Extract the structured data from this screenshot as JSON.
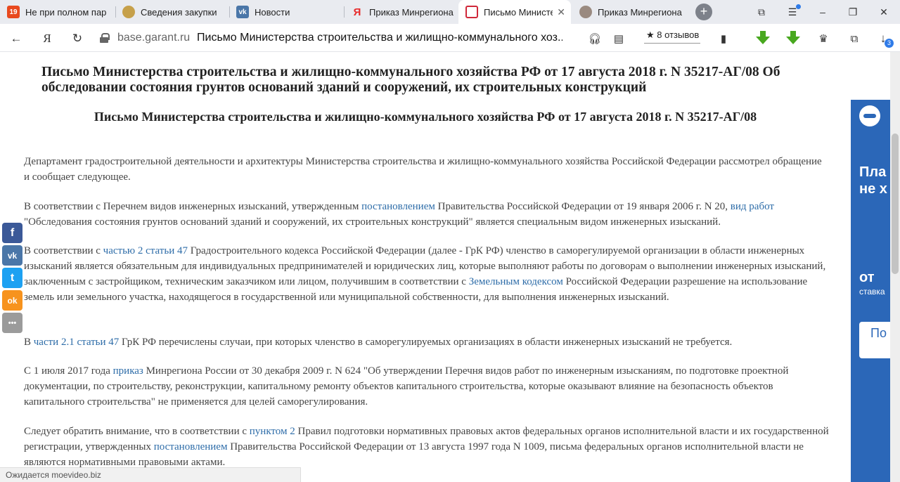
{
  "tabs": [
    {
      "label": "Не при полном пар",
      "favicon_text": "19",
      "favicon_color": "#e8491e"
    },
    {
      "label": "Сведения закупки",
      "favicon_text": "",
      "favicon_color": "#c6a04a"
    },
    {
      "label": "Новости",
      "favicon_text": "vk",
      "favicon_color": "#4a76a8"
    },
    {
      "label": "Приказ Минрегиона",
      "favicon_text": "Я",
      "favicon_color": "#e82a2a"
    },
    {
      "label": "Письмо Министе",
      "favicon_text": "",
      "favicon_color": "#d0283a",
      "active": true
    },
    {
      "label": "Приказ Минрегиона",
      "favicon_text": "",
      "favicon_color": "#9a8a80"
    }
  ],
  "addressbar": {
    "domain": "base.garant.ru",
    "title": "Письмо Министерства строительства и жилищно-коммунального хоз...",
    "reviews_label": "8 отзывов",
    "downloads_count": "3"
  },
  "article": {
    "heading": "Письмо Министерства строительства и жилищно-коммунального хозяйства РФ от 17 августа 2018 г. N 35217-АГ/08 Об обследовании состояния грунтов оснований зданий и сооружений, их строительных конструкций",
    "subheading": "Письмо Министерства строительства и жилищно-коммунального хозяйства РФ от 17 августа 2018 г. N 35217-АГ/08",
    "p1": "Департамент градостроительной деятельности и архитектуры Министерства строительства и жилищно-коммунального хозяйства Российской Федерации рассмотрел обращение и сообщает следующее.",
    "p2": {
      "t1": "В соответствии с Перечнем видов инженерных изысканий, утвержденным ",
      "l1": "постановлением",
      "t2": " Правительства Российской Федерации от 19 января 2006 г. N 20, ",
      "l2": "вид работ",
      "t3": " \"Обследования состояния грунтов оснований зданий и сооружений, их строительных конструкций\" является специальным видом инженерных изысканий."
    },
    "p3": {
      "t1": "В соответствии с ",
      "l1": "частью 2 статьи 47",
      "t2": " Градостроительного кодекса Российской Федерации (далее - ГрК РФ) членство в саморегулируемой организации в области инженерных изысканий является обязательным для индивидуальных предпринимателей и юридических лиц, которые выполняют работы по договорам о выполнении инженерных изысканий, заключенным с застройщиком, техническим заказчиком или лицом, получившим в соответствии с ",
      "l2": "Земельным кодексом",
      "t3": " Российской Федерации разрешение на использование земель или земельного участка, находящегося в государственной или муниципальной собственности, для выполнения инженерных изысканий."
    },
    "p4": {
      "t1": "В ",
      "l1": "части 2.1 статьи 47",
      "t2": " ГрК РФ перечислены случаи, при которых членство в саморегулируемых организациях в области инженерных изысканий не требуется."
    },
    "p5": {
      "t1": "С 1 июля 2017 года ",
      "l1": "приказ",
      "t2": " Минрегиона России от 30 декабря 2009 г. N 624 \"Об утверждении Перечня видов работ по инженерным изысканиям, по подготовке проектной документации, по строительству, реконструкции, капитальному ремонту объектов капитального строительства, которые оказывают влияние на безопасность объектов капитального строительства\" не применяется для целей саморегулирования."
    },
    "p6": {
      "t1": "Следует обратить внимание, что в соответствии с ",
      "l1": "пунктом 2",
      "t2": " Правил подготовки нормативных правовых актов федеральных органов исполнительной власти и их государственной регистрации, утвержденных ",
      "l2": "постановлением",
      "t3": " Правительства Российской Федерации от 13 августа 1997 года N 1009, письма федеральных органов исполнительной власти не являются нормативными правовыми актами."
    }
  },
  "share_buttons": [
    {
      "name": "facebook-share-button",
      "icon": "facebook-icon",
      "glyph": "f",
      "color": "#3b5998"
    },
    {
      "name": "vk-share-button",
      "icon": "vk-icon",
      "glyph": "vk",
      "color": "#4a76a8"
    },
    {
      "name": "twitter-share-button",
      "icon": "twitter-icon",
      "glyph": "t",
      "color": "#1da1f2"
    },
    {
      "name": "odnoklassniki-share-button",
      "icon": "odnoklassniki-icon",
      "glyph": "ok",
      "color": "#f7931e"
    },
    {
      "name": "more-share-button",
      "icon": "more-icon",
      "glyph": "•••",
      "color": "#9b9b9b"
    }
  ],
  "status_text": "Ожидается moevideo.biz",
  "ad": {
    "line1": "Пла",
    "line2": "не х",
    "line3": "от",
    "line4": "ставка",
    "button": "По к"
  }
}
